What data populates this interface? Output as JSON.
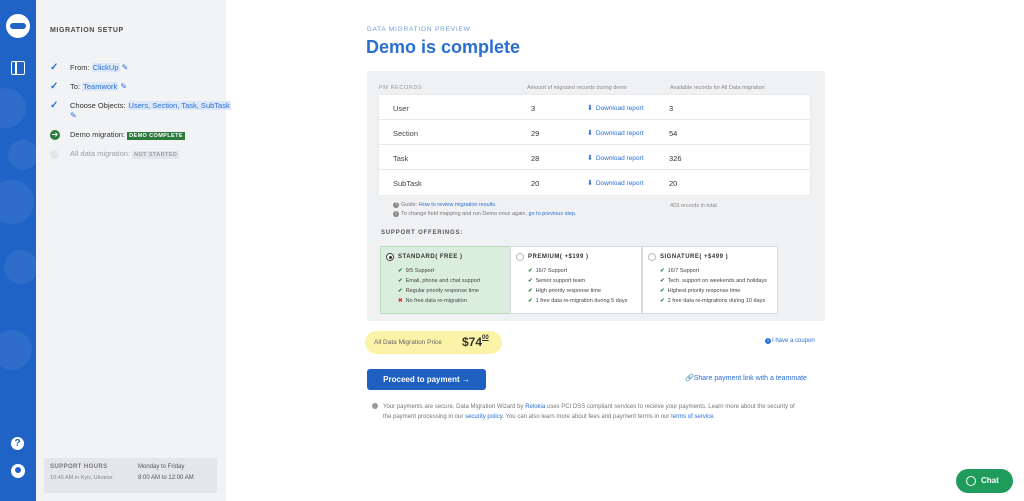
{
  "sidebar": {
    "title": "MIGRATION SETUP",
    "steps": {
      "from": {
        "label": "From:",
        "value": "ClickUp"
      },
      "to": {
        "label": "To:",
        "value": "Teamwork"
      },
      "objects": {
        "label": "Choose Objects:",
        "value": "Users, Section, Task, SubTask"
      },
      "demo": {
        "label": "Demo migration:",
        "badge": "DEMO COMPLETE"
      },
      "all": {
        "label": "All data migration:",
        "badge": "NOT STARTED"
      }
    },
    "support": {
      "title": "SUPPORT HOURS",
      "local_time": "10:46 AM in Kyiv, Ukraine",
      "days": "Monday to Friday",
      "hours": "8:00 AM to 12:00 AM"
    }
  },
  "header": {
    "eyebrow": "DATA MIGRATION PREVIEW",
    "title": "Demo is complete"
  },
  "records": {
    "section_label": "PM RECORDS",
    "col_amount": "Amount of migrated records during demo",
    "col_available": "Available records for All Data migration",
    "download_label": "Download report",
    "rows": [
      {
        "name": "User",
        "migrated": "3",
        "available": "3"
      },
      {
        "name": "Section",
        "migrated": "29",
        "available": "54"
      },
      {
        "name": "Task",
        "migrated": "28",
        "available": "326"
      },
      {
        "name": "SubTask",
        "migrated": "20",
        "available": "20"
      }
    ],
    "guide_prefix": "Guide:",
    "guide_link": "How to review migration results.",
    "change_prefix": "To change field mapping and run Demo once again,",
    "change_link": "go to previous step.",
    "total": "403 records in total"
  },
  "support_offerings": {
    "title": "SUPPORT OFFERINGS:",
    "plans": [
      {
        "name": "STANDARD( FREE )",
        "selected": true,
        "features": [
          "9/5 Support",
          "Email, phone and chat support",
          "Regular priority response time"
        ],
        "excluded": "No free data re-migration"
      },
      {
        "name": "PREMIUM( +$199 )",
        "selected": false,
        "features": [
          "16/7 Support",
          "Senior support team",
          "High priority response time",
          "1 free data re-migration during 5 days"
        ]
      },
      {
        "name": "SIGNATURE( +$499 )",
        "selected": false,
        "features": [
          "16/7 Support",
          "Tech. support on weekends and holidays",
          "Highest priority response time",
          "2 free data re-migrations during 10 days"
        ]
      }
    ]
  },
  "price": {
    "label": "All Data Migration Price",
    "dollars": "$74",
    "cents": "00"
  },
  "coupon_label": "I have a coupon",
  "proceed_label": "Proceed to payment →",
  "share_label": "Share payment link with a teammate",
  "secure": {
    "text1": "Your payments are secure. Data Migration Wizard by",
    "brand": "Relokia",
    "text2": "uses PCI DSS compliant services to receive your payments. Learn more about the security of the payment processing in our",
    "policy_link": "security policy",
    "text3": ". You can also learn more about fees and payment terms in our",
    "terms_link": "terms of service",
    "text4": "."
  },
  "chat_label": "Chat",
  "colors": {
    "brand_blue": "#1f63c6",
    "link_blue": "#2a6fd6",
    "success_green": "#2c7a3c",
    "chat_green": "#1f9b5b",
    "price_highlight": "#fbf3a8"
  }
}
